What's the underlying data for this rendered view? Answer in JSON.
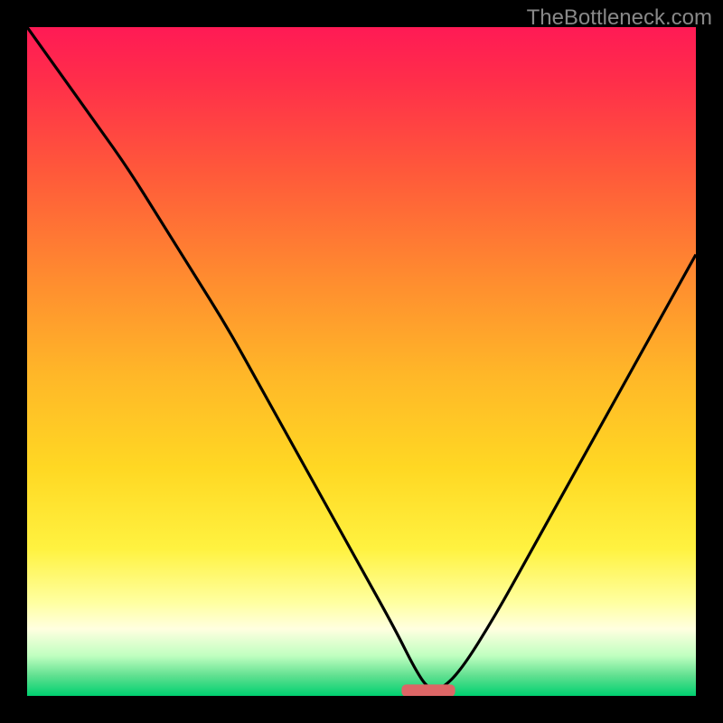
{
  "watermark": "TheBottleneck.com",
  "chart_data": {
    "type": "line",
    "title": "",
    "xlabel": "",
    "ylabel": "",
    "x_range": [
      0,
      100
    ],
    "y_range": [
      0,
      100
    ],
    "series": [
      {
        "name": "bottleneck-curve",
        "x": [
          0,
          5,
          10,
          15,
          20,
          25,
          30,
          35,
          40,
          45,
          50,
          55,
          58,
          60,
          62,
          65,
          70,
          75,
          80,
          85,
          90,
          95,
          100
        ],
        "y": [
          100,
          93,
          86,
          79,
          71,
          63,
          55,
          46,
          37,
          28,
          19,
          10,
          4,
          1,
          1,
          4,
          12,
          21,
          30,
          39,
          48,
          57,
          66
        ]
      }
    ],
    "optimum": {
      "x_start": 56,
      "x_end": 64,
      "y": 0.5
    },
    "gradient_stops": [
      {
        "pos": 0.0,
        "color": "#ff1a55"
      },
      {
        "pos": 0.5,
        "color": "#ffb728"
      },
      {
        "pos": 0.85,
        "color": "#ffffa0"
      },
      {
        "pos": 1.0,
        "color": "#00d070"
      }
    ]
  }
}
